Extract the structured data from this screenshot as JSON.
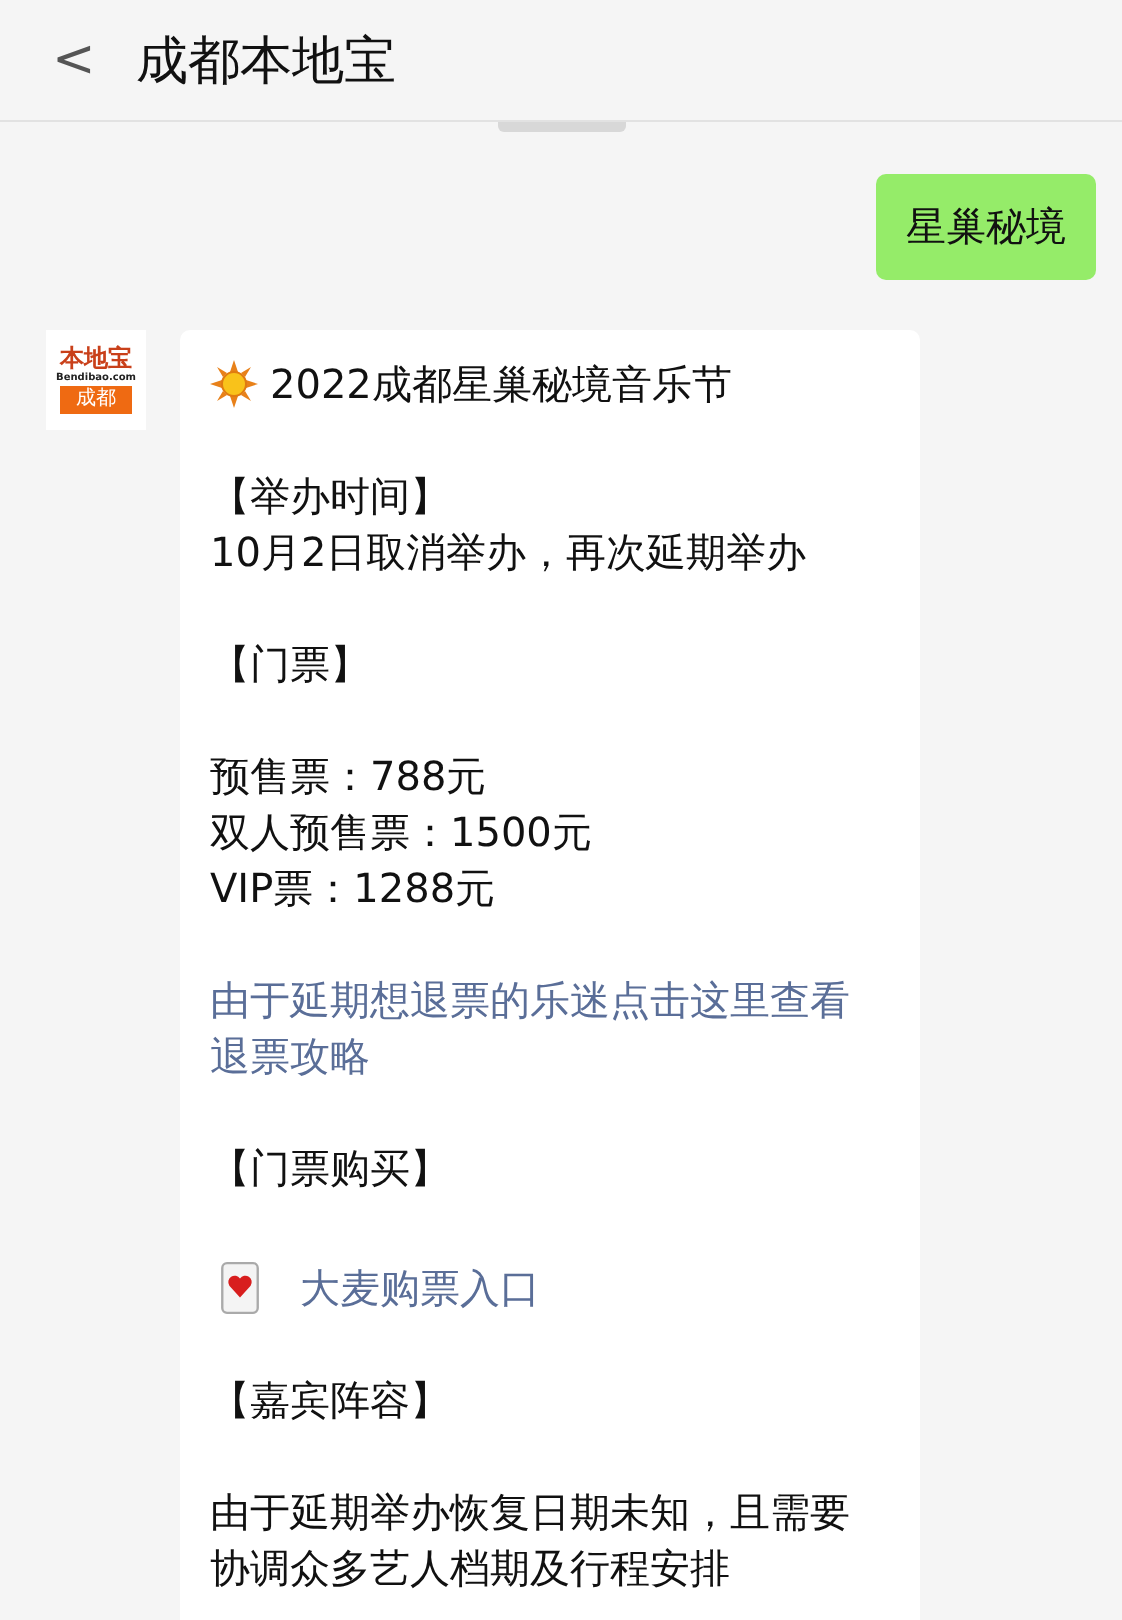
{
  "header": {
    "back": "<",
    "title": "成都本地宝"
  },
  "sent": {
    "text": "星巢秘境"
  },
  "received": {
    "avatar": {
      "brand": "本地宝",
      "site": "Bendibao.com",
      "city": "成都"
    },
    "blocks": [
      {
        "kind": "title",
        "lines": [
          "2022成都星巢秘境音乐节"
        ]
      },
      {
        "kind": "text",
        "lines": [
          "【举办时间】",
          "10月2日取消举办，再次延期举办"
        ]
      },
      {
        "kind": "text",
        "lines": [
          "【门票】"
        ]
      },
      {
        "kind": "text",
        "lines": [
          "预售票：788元",
          "双人预售票：1500元",
          "VIP票：1288元"
        ]
      },
      {
        "kind": "link",
        "lines": [
          "由于延期想退票的乐迷点击这里查看",
          "退票攻略"
        ]
      },
      {
        "kind": "text",
        "lines": [
          "【门票购买】"
        ]
      },
      {
        "kind": "card_link",
        "lines": [
          "大麦购票入口"
        ]
      },
      {
        "kind": "text",
        "lines": [
          "【嘉宾阵容】"
        ]
      },
      {
        "kind": "text",
        "lines": [
          "由于延期举办恢复日期未知，且需要",
          "协调众多艺人档期及行程安排"
        ]
      }
    ]
  }
}
